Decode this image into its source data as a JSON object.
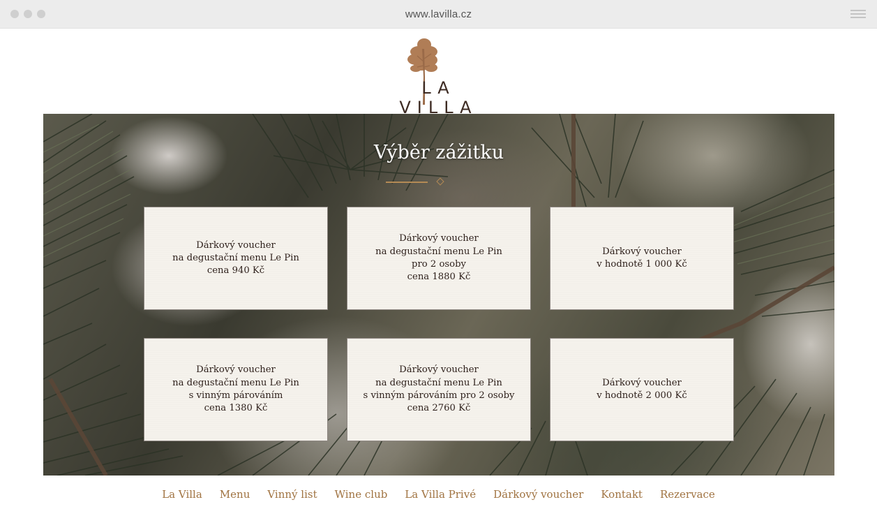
{
  "browser": {
    "url": "www.lavilla.cz",
    "menu_icon": "hamburger-menu-icon",
    "window_controls": [
      "close",
      "minimize",
      "maximize"
    ]
  },
  "logo": {
    "text": "LA VILLA",
    "icon": "pine-tree-icon",
    "color": "#3c2a22",
    "tree_color": "#b07d56"
  },
  "hero": {
    "title": "Výběr zážitku",
    "accent_color": "#b48a55"
  },
  "vouchers": [
    {
      "lines": [
        "Dárkový voucher",
        "na degustační menu Le Pin",
        "cena 940 Kč"
      ]
    },
    {
      "lines": [
        "Dárkový voucher",
        "na degustační menu Le Pin",
        "pro 2 osoby",
        "cena 1880 Kč"
      ]
    },
    {
      "lines": [
        "Dárkový voucher",
        "v hodnotě 1 000 Kč"
      ]
    },
    {
      "lines": [
        "Dárkový voucher",
        "na degustační menu Le Pin",
        "s vinným párováním",
        "cena 1380 Kč"
      ]
    },
    {
      "lines": [
        "Dárkový voucher",
        "na degustační menu Le Pin",
        "s vinným párováním pro 2 osoby",
        "cena 2760 Kč"
      ]
    },
    {
      "lines": [
        "Dárkový voucher",
        "v hodnotě 2 000 Kč"
      ]
    }
  ],
  "nav": {
    "color": "#a07341",
    "items": [
      "La Villa",
      "Menu",
      "Vinný list",
      "Wine club",
      "La Villa Privé",
      "Dárkový voucher",
      "Kontakt",
      "Rezervace"
    ]
  }
}
